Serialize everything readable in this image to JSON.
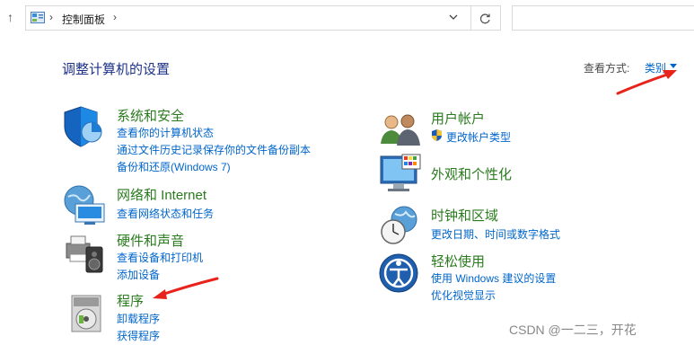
{
  "address": {
    "breadcrumb": "控制面板",
    "separator": "›"
  },
  "header": {
    "title": "调整计算机的设置",
    "view_by_label": "查看方式:",
    "view_by_value": "类别"
  },
  "categories": [
    {
      "title": "系统和安全",
      "icon": "shield-pie-icon",
      "links": [
        "查看你的计算机状态",
        "通过文件历史记录保存你的文件备份副本",
        "备份和还原(Windows 7)"
      ]
    },
    {
      "title": "网络和 Internet",
      "icon": "network-globe-icon",
      "links": [
        "查看网络状态和任务"
      ]
    },
    {
      "title": "硬件和声音",
      "icon": "printer-speaker-icon",
      "links": [
        "查看设备和打印机",
        "添加设备"
      ]
    },
    {
      "title": "程序",
      "icon": "programs-disc-icon",
      "links": [
        "卸载程序",
        "获得程序"
      ]
    },
    {
      "title": "用户帐户",
      "icon": "users-icon",
      "links": [
        "更改帐户类型"
      ]
    },
    {
      "title": "外观和个性化",
      "icon": "monitor-palette-icon",
      "links": []
    },
    {
      "title": "时钟和区域",
      "icon": "clock-globe-icon",
      "links": [
        "更改日期、时间或数字格式"
      ]
    },
    {
      "title": "轻松使用",
      "icon": "accessibility-icon",
      "links": [
        "使用 Windows 建议的设置",
        "优化视觉显示"
      ]
    }
  ],
  "watermark": "CSDN @一二三，开花",
  "colors": {
    "category": "#2a7b1e",
    "link": "#0066cc",
    "title": "#1e3287",
    "arrow": "#e8231b"
  }
}
